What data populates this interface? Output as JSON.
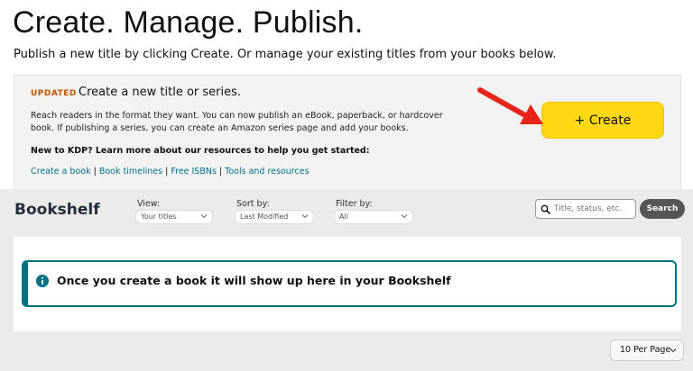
{
  "header": {
    "title": "Create. Manage. Publish.",
    "subtitle": "Publish a new title by clicking Create. Or manage your existing titles from your books below."
  },
  "create_panel": {
    "badge": "UPDATED",
    "heading": "Create a new title or series.",
    "description": "Reach readers in the format they want. You can now publish an eBook, paperback, or hardcover book. If publishing a series, you can create an Amazon series page and add your books.",
    "learn_more": "New to KDP? Learn more about our resources to help you get started:",
    "links": [
      "Create a book",
      "Book timelines",
      "Free ISBNs",
      "Tools and resources"
    ],
    "link_separator": " | ",
    "create_button": "+ Create"
  },
  "bookshelf": {
    "title": "Bookshelf",
    "view": {
      "label": "View:",
      "value": "Your titles"
    },
    "sort": {
      "label": "Sort by:",
      "value": "Last Modified"
    },
    "filter": {
      "label": "Filter by:",
      "value": "All"
    },
    "search": {
      "placeholder": "Title, status, etc.",
      "button": "Search"
    },
    "empty_message": "Once you create a book it will show up here in your Bookshelf",
    "per_page": "10 Per Page"
  },
  "colors": {
    "accent_yellow": "#ffd814",
    "link_teal": "#007185",
    "badge_orange": "#c45500",
    "arrow_red": "#e8231a"
  },
  "icons": [
    "red-arrow-icon",
    "search-icon",
    "info-icon",
    "chevron-down-icon"
  ]
}
